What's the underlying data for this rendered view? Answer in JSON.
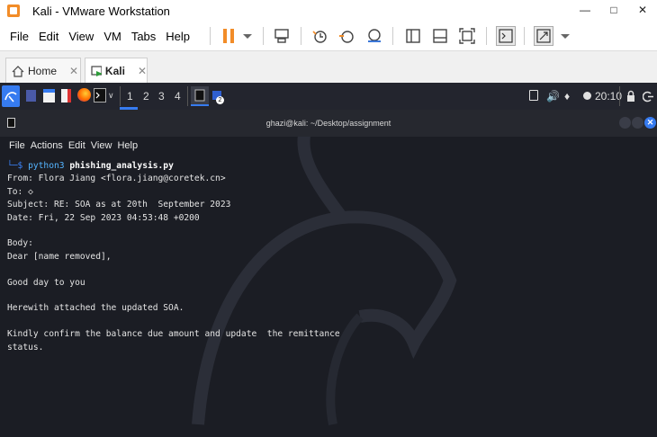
{
  "window": {
    "title": "Kali - VMware Workstation"
  },
  "menu": [
    "File",
    "Edit",
    "View",
    "VM",
    "Tabs",
    "Help"
  ],
  "tabs": [
    {
      "label": "Home"
    },
    {
      "label": "Kali"
    }
  ],
  "kali_panel": {
    "workspaces": [
      "1",
      "2",
      "3",
      "4"
    ],
    "clock": "20:10"
  },
  "terminal": {
    "title": "ghazi@kali: ~/Desktop/assignment",
    "menu": [
      "File",
      "Actions",
      "Edit",
      "View",
      "Help"
    ],
    "prompt_prefix": "└─$",
    "command": "python3",
    "script": "phishing_analysis.py",
    "output_lines": [
      "From: Flora Jiang <flora.jiang@coretek.cn>",
      "To: ◇",
      "Subject: RE: SOA as at 20th  September 2023",
      "Date: Fri, 22 Sep 2023 04:53:48 +0200",
      "",
      "Body:",
      "Dear [name removed],",
      "",
      "Good day to you",
      "",
      "Herewith attached the updated SOA.",
      "",
      "Kindly confirm the balance due amount and update  the remittance",
      "status."
    ]
  },
  "colors": {
    "accent_orange": "#f28c28",
    "kali_blue": "#367bf0",
    "terminal_bg": "#1b1d24"
  }
}
